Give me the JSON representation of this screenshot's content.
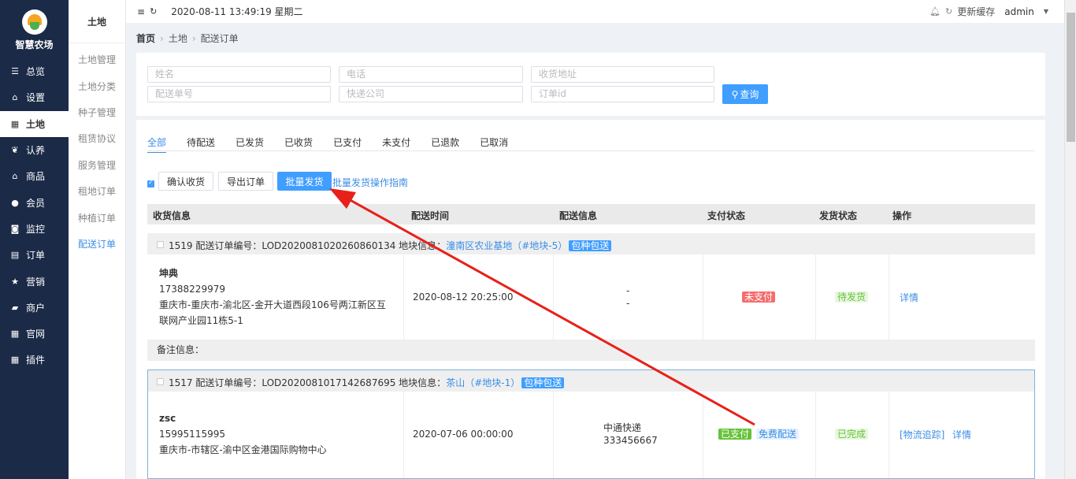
{
  "app": {
    "name": "智慧农场"
  },
  "nav": [
    {
      "icon": "sliders-icon",
      "label": "总览"
    },
    {
      "icon": "home-icon",
      "label": "设置"
    },
    {
      "icon": "grid-icon",
      "label": "土地"
    },
    {
      "icon": "sprout-icon",
      "label": "认养"
    },
    {
      "icon": "shop-icon",
      "label": "商品"
    },
    {
      "icon": "user-icon",
      "label": "会员"
    },
    {
      "icon": "camera-icon",
      "label": "监控"
    },
    {
      "icon": "clipboard-icon",
      "label": "订单"
    },
    {
      "icon": "star-icon",
      "label": "营销"
    },
    {
      "icon": "store-icon",
      "label": "商户"
    },
    {
      "icon": "grid-icon",
      "label": "官网"
    },
    {
      "icon": "grid-icon",
      "label": "插件"
    }
  ],
  "subnav": {
    "title": "土地",
    "items": [
      "土地管理",
      "土地分类",
      "种子管理",
      "租赁协议",
      "服务管理",
      "租地订单",
      "种植订单",
      "配送订单"
    ]
  },
  "topbar": {
    "datetime": "2020-08-11 13:49:19 星期二",
    "cache": "更新缓存",
    "user": "admin"
  },
  "breadcrumb": {
    "home": "首页",
    "level1": "土地",
    "current": "配送订单"
  },
  "filters": {
    "name": "姓名",
    "phone": "电话",
    "address": "收货地址",
    "delivery_no": "配送单号",
    "courier": "快递公司",
    "order_id": "订单id",
    "query_label": "查询"
  },
  "tabs": [
    "全部",
    "待配送",
    "已发货",
    "已收货",
    "已支付",
    "未支付",
    "已退款",
    "已取消"
  ],
  "actions": {
    "confirm": "确认收货",
    "export": "导出订单",
    "batch": "批量发货",
    "guide": "批量发货操作指南"
  },
  "columns": [
    "收货信息",
    "配送时间",
    "配送信息",
    "支付状态",
    "发货状态",
    "操作"
  ],
  "orders": [
    {
      "header_prefix": "1519 配送订单编号：LOD2020081020260860134  地块信息：",
      "location": "潼南区农业基地（#地块-5）",
      "tag": "包种包送",
      "name": "坤典",
      "phone": "17388229979",
      "address1": "重庆市-重庆市-渝北区-金开大道西段106号两江新区互",
      "address2": "联网产业园11栋5-1",
      "time": "2020-08-12 20:25:00",
      "ship1": "-",
      "ship2": "-",
      "pay": "未支付",
      "status": "待发货",
      "op": "详情",
      "remark": "备注信息："
    },
    {
      "header_prefix": "1517 配送订单编号：LOD2020081017142687695  地块信息：",
      "location": "茶山（#地块-1）",
      "tag": "包种包送",
      "name": "zsc",
      "phone": "15995115995",
      "address1": "重庆市-市辖区-渝中区金港国际购物中心",
      "time": "2020-07-06 00:00:00",
      "ship1": "中通快递",
      "ship2": "333456667",
      "pay": "已支付",
      "pay_extra": "免费配送",
      "status": "已完成",
      "op_track": "[物流追踪]",
      "op": "详情"
    }
  ],
  "colors": {
    "sidebar": "#1b2a47",
    "accent": "#409eff",
    "annotation": "#e8201a"
  }
}
